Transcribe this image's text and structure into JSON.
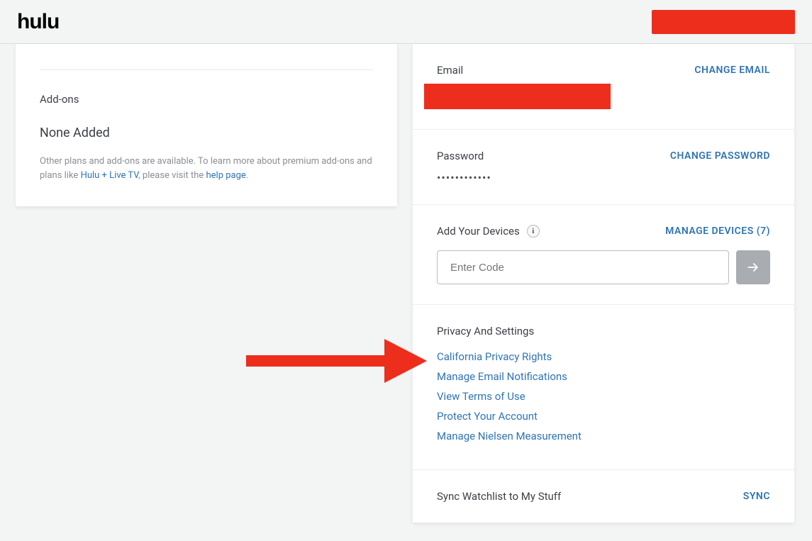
{
  "header": {
    "logo": "hulu"
  },
  "addons": {
    "title": "Add-ons",
    "noneAdded": "None Added",
    "descPrefix": "Other plans and add-ons are available. To learn more about premium add-ons and plans like ",
    "linkLiveTV": "Hulu + Live TV",
    "descMiddle": ", please visit the ",
    "linkHelp": "help page",
    "descSuffix": "."
  },
  "email": {
    "label": "Email",
    "action": "CHANGE EMAIL"
  },
  "password": {
    "label": "Password",
    "action": "CHANGE PASSWORD",
    "dots": "••••••••••••"
  },
  "devices": {
    "label": "Add Your Devices",
    "action": "MANAGE DEVICES (7)",
    "placeholder": "Enter Code"
  },
  "privacy": {
    "title": "Privacy And Settings",
    "links": {
      "l0": "California Privacy Rights",
      "l1": "Manage Email Notifications",
      "l2": "View Terms of Use",
      "l3": "Protect Your Account",
      "l4": "Manage Nielsen Measurement"
    }
  },
  "sync": {
    "label": "Sync Watchlist to My Stuff",
    "action": "SYNC"
  }
}
